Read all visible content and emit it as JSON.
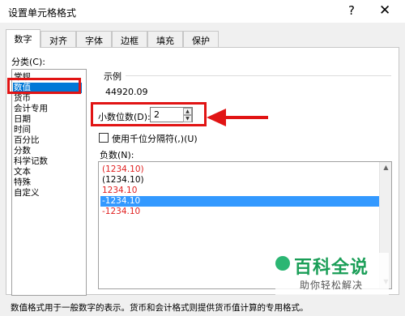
{
  "window": {
    "title": "设置单元格格式",
    "help_label": "?",
    "close_label": "✕"
  },
  "tabs": [
    {
      "label": "数字",
      "active": true
    },
    {
      "label": "对齐",
      "active": false
    },
    {
      "label": "字体",
      "active": false
    },
    {
      "label": "边框",
      "active": false
    },
    {
      "label": "填充",
      "active": false
    },
    {
      "label": "保护",
      "active": false
    }
  ],
  "category": {
    "label": "分类(C):",
    "items": [
      "常规",
      "数值",
      "货币",
      "会计专用",
      "日期",
      "时间",
      "百分比",
      "分数",
      "科学记数",
      "文本",
      "特殊",
      "自定义"
    ],
    "selected_index": 1
  },
  "sample": {
    "label": "示例",
    "value": "44920.09"
  },
  "decimal_places": {
    "label": "小数位数(D):",
    "value": "2",
    "up_label": "▲",
    "down_label": "▼"
  },
  "thousands_separator": {
    "label": "使用千位分隔符(,)(U)",
    "checked": false
  },
  "negative_numbers": {
    "label": "负数(N):",
    "items": [
      {
        "text": "(1234.10)",
        "color": "#e02020"
      },
      {
        "text": "(1234.10)",
        "color": "#000000"
      },
      {
        "text": "1234.10",
        "color": "#e02020"
      },
      {
        "text": "-1234.10",
        "color": "#ffffff"
      },
      {
        "text": "-1234.10",
        "color": "#e02020"
      }
    ],
    "selected_index": 3
  },
  "watermark": {
    "title": "百科全说",
    "subtitle": "助你轻松解决"
  },
  "footer_text": "数值格式用于一般数字的表示。货币和会计格式则提供货币值计算的专用格式。",
  "colors": {
    "accent_red": "#e11414",
    "selection_blue": "#0078d7",
    "list_selection_blue": "#3399ff",
    "watermark_green": "#1a9e57"
  }
}
